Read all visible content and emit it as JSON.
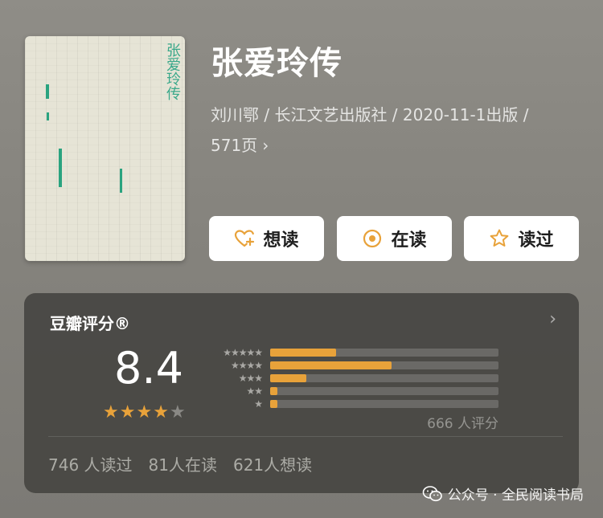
{
  "book": {
    "cover_title": "张爱玲传",
    "title": "张爱玲传",
    "meta_line1": "刘川鄂 / 长江文艺出版社 / 2020-11-1出版 /",
    "meta_line2": "571页"
  },
  "actions": [
    {
      "label": "想读",
      "icon": "heart-plus-icon"
    },
    {
      "label": "在读",
      "icon": "target-circle-icon"
    },
    {
      "label": "读过",
      "icon": "star-outline-icon"
    }
  ],
  "rating": {
    "header": "豆瓣评分®",
    "score": "8.4",
    "stars": 4,
    "distribution": [
      {
        "stars": 5,
        "fraction": 0.29
      },
      {
        "stars": 4,
        "fraction": 0.53
      },
      {
        "stars": 3,
        "fraction": 0.16
      },
      {
        "stars": 2,
        "fraction": 0.03
      },
      {
        "stars": 1,
        "fraction": 0.03
      }
    ],
    "count": "666 人评分",
    "read": "746 人读过",
    "reading": "81人在读",
    "want": "621人想读"
  },
  "watermark": {
    "text": "公众号 · 全民阅读书局"
  },
  "colors": {
    "accent": "#e8a23a",
    "star_empty": "#8a8985",
    "cover_green": "#2aa37f"
  }
}
